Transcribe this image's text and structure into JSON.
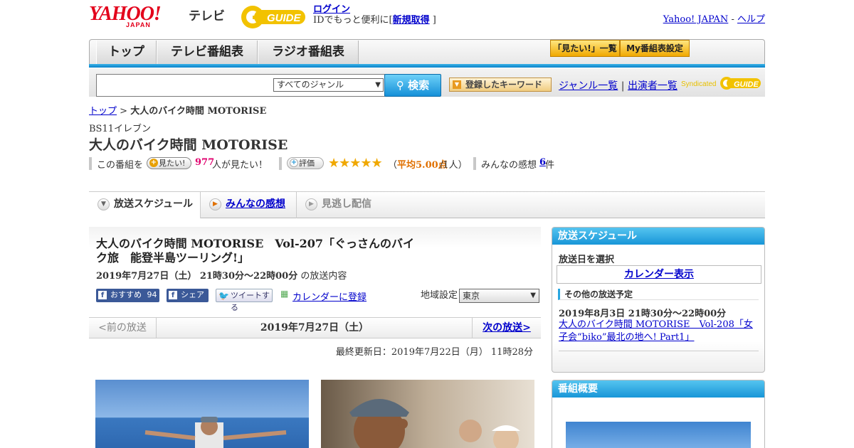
{
  "header": {
    "yahoo_logo": "YAHOO!",
    "yahoo_japan": "JAPAN",
    "tv": "テレビ",
    "gguide_logo": "GUIDE",
    "login": "ログイン",
    "login_desc_pre": "IDでもっと便利に[",
    "register": "新規取得",
    "login_desc_post": "]",
    "yahoo_japan_link": "Yahoo! JAPAN",
    "sep": " - ",
    "help": "ヘルプ"
  },
  "nav": {
    "tabs": [
      "トップ",
      "テレビ番組表",
      "ラジオ番組表"
    ],
    "mitai_list": "「見たい!」一覧",
    "my_bangumi": "My番組表設定"
  },
  "search": {
    "placeholder": "",
    "genre": "すべてのジャンル",
    "button": "検索",
    "keyword_button": "登録したキーワード",
    "genre_list": "ジャンル一覧",
    "divider": "|",
    "performers": "出演者一覧",
    "syndicated": "Syndicated"
  },
  "breadcrumb": {
    "top": "トップ",
    "sep": " > ",
    "current": "大人のバイク時間 MOTORISE"
  },
  "program": {
    "station": "BS11イレブン",
    "title": "大人のバイク時間 MOTORISE",
    "this_program": "この番組を",
    "mitai_btn": "見たい!",
    "mitai_count": "977",
    "mitai_suffix": "人が見たい！",
    "rating_btn": "評価",
    "stars": "★★★★★",
    "rating_open": "（",
    "rating_avg": "平均5.00点",
    "rating_people": "/1人）",
    "impressions_label": "みんなの感想",
    "impressions_count": "6",
    "impressions_suffix": "件"
  },
  "page_tabs": {
    "schedule": "放送スケジュール",
    "impressions": "みんなの感想",
    "missed": "見逃し配信"
  },
  "episode": {
    "title": "大人のバイク時間 MOTORISE　Vol-207「ぐっさんのバイク旅　能登半島ツーリング!」",
    "datetime": "2019年7月27日（土） 21時30分～22時00分",
    "datetime_suffix": " の放送内容",
    "fb_recommend": "おすすめ",
    "fb_count": "94",
    "fb_share": "シェア",
    "tweet": "ツイートする",
    "calendar_register": "カレンダーに登録",
    "region_label": "地域設定",
    "region": "東京",
    "prev": "<前の放送",
    "current_date": "2019年7月27日（土）",
    "next": "次の放送>",
    "updated": "最終更新日：2019年7月22日（月） 11時28分"
  },
  "sidebar": {
    "schedule_head": "放送スケジュール",
    "select_day": "放送日を選択",
    "calendar": "カレンダー表示",
    "other_schedule": "その他の放送予定",
    "other_date": "2019年8月3日 21時30分～22時00分",
    "other_title": "大人のバイク時間 MOTORISE　Vol-208「女子会“biko”最北の地へ! Part1」",
    "summary_head": "番組概要"
  },
  "colors": {
    "accent_blue": "#1896d8",
    "yahoo_red": "#e3001b",
    "star": "#f0a800",
    "count_pink": "#e0006e"
  }
}
